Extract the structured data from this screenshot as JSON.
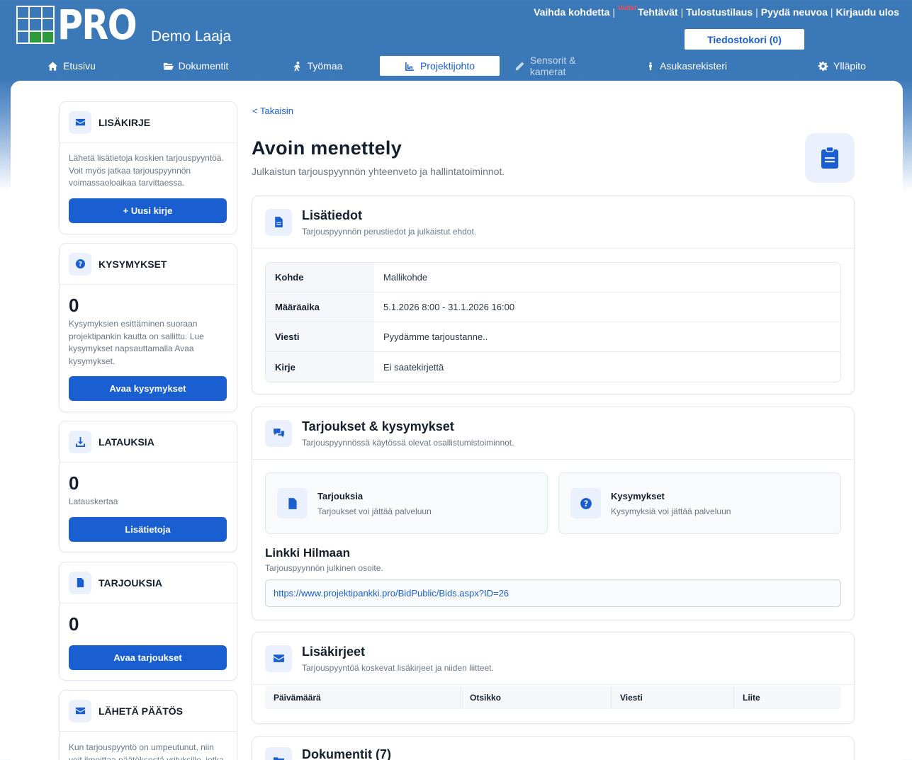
{
  "header": {
    "logo_text": "PRO",
    "site_name": "Demo Laaja",
    "top_links": {
      "change_target": "Vaihda kohdetta",
      "new_badge": "Uutta!",
      "tasks": "Tehtävät",
      "print_order": "Tulostustilaus",
      "ask_help": "Pyydä neuvoa",
      "logout": "Kirjaudu ulos"
    },
    "file_basket": "Tiedostokori (0)"
  },
  "nav": {
    "home": "Etusivu",
    "documents": "Dokumentit",
    "worksite": "Työmaa",
    "project_management": "Projektijohto",
    "sensors": "Sensorit & kamerat",
    "resident_registry": "Asukasrekisteri",
    "admin": "Ylläpito"
  },
  "sidebar": {
    "letter": {
      "title": "LISÄKIRJE",
      "text": "Lähetä lisätietoja koskien tarjouspyyntöä. Voit myös jatkaa tarjouspyynnön voimassaoloaikaa tarvittaessa.",
      "button": "+ Uusi kirje"
    },
    "questions": {
      "title": "KYSYMYKSET",
      "count": "0",
      "text": "Kysymyksien esittäminen suoraan projektipankin kautta on sallittu. Lue kysymykset napsauttamalla Avaa kysymykset.",
      "button": "Avaa kysymykset"
    },
    "downloads": {
      "title": "LATAUKSIA",
      "count": "0",
      "text": "Latauskertaa",
      "button": "Lisätietoja"
    },
    "offers": {
      "title": "TARJOUKSIA",
      "count": "0",
      "button": "Avaa tarjoukset"
    },
    "decision": {
      "title": "LÄHETÄ PÄÄTÖS",
      "text": "Kun tarjouspyyntö on umpeutunut, niin voit ilmoittaa päätöksestä yrityksille, jotka ovat"
    }
  },
  "main": {
    "back": "< Takaisin",
    "title": "Avoin menettely",
    "subtitle": "Julkaistun tarjouspyynnön yhteenveto ja hallintatoiminnot.",
    "details": {
      "title": "Lisätiedot",
      "subtitle": "Tarjouspyynnön perustiedot ja julkaistut ehdot.",
      "rows": [
        {
          "key": "Kohde",
          "value": "Mallikohde"
        },
        {
          "key": "Määräaika",
          "value": "5.1.2026 8:00 - 31.1.2026 16:00"
        },
        {
          "key": "Viesti",
          "value": "Pyydämme tarjoustanne.."
        },
        {
          "key": "Kirje",
          "value": "Ei saatekirjettä"
        }
      ]
    },
    "participation": {
      "title": "Tarjoukset & kysymykset",
      "subtitle": "Tarjouspyynnössä käytössä olevat osallistumistoiminnot.",
      "offers_title": "Tarjouksia",
      "offers_sub": "Tarjoukset voi jättää palveluun",
      "questions_title": "Kysymykset",
      "questions_sub": "Kysymyksiä voi jättää palveluun",
      "link_title": "Linkki Hilmaan",
      "link_sub": "Tarjouspyynnön julkinen osoite.",
      "link_url": "https://www.projektipankki.pro/BidPublic/Bids.aspx?ID=26"
    },
    "letters": {
      "title": "Lisäkirjeet",
      "subtitle": "Tarjouspyyntöä koskevat lisäkirjeet ja niiden liitteet.",
      "columns": [
        "Päivämäärä",
        "Otsikko",
        "Viesti",
        "Liite"
      ]
    },
    "documents": {
      "title": "Dokumentit (7)"
    }
  },
  "colors": {
    "header_blue": "#3b78b8",
    "accent": "#1a5fd1",
    "new_badge": "#ff4a4a"
  }
}
